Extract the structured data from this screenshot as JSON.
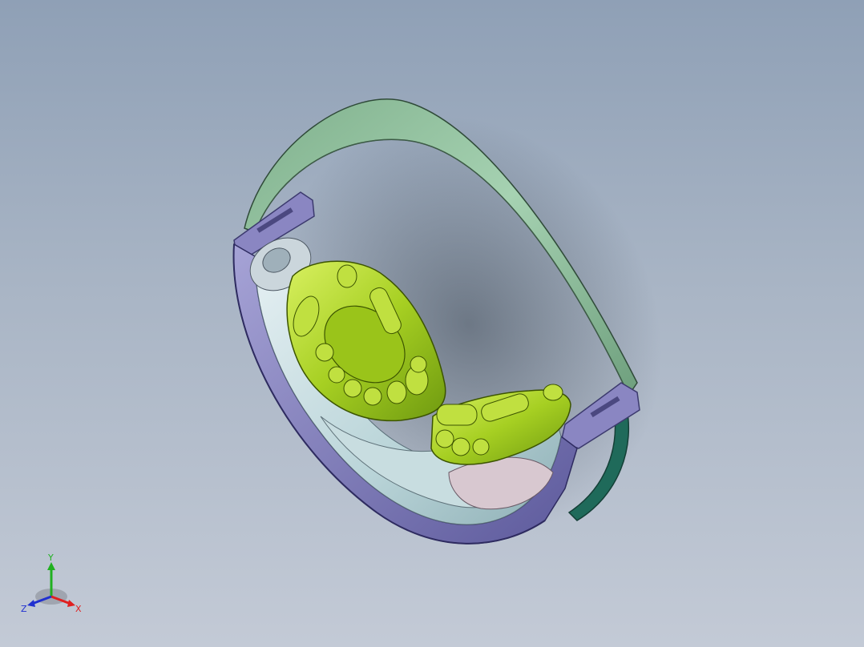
{
  "viewport": {
    "background_top": "#8fa0b6",
    "background_bottom": "#c3cad6"
  },
  "model": {
    "band_color": "#93c4a0",
    "pad_color": "#a6cf22",
    "housing_color": "#7f7bb8",
    "panel_color": "#1f6a5a"
  },
  "triad": {
    "x_label": "X",
    "y_label": "Y",
    "z_label": "Z",
    "x_color": "#e02020",
    "y_color": "#20b020",
    "z_color": "#2030d0"
  }
}
